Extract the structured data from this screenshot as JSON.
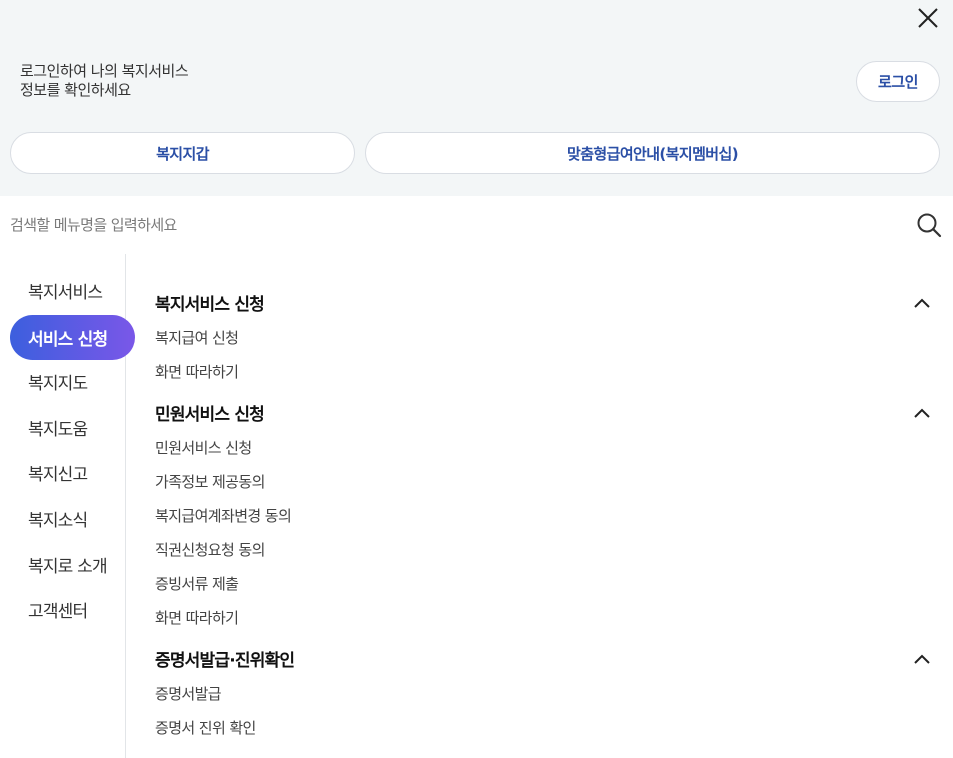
{
  "header": {
    "login_message_line1": "로그인하여 나의 복지서비스",
    "login_message_line2": "정보를 확인하세요",
    "login_label": "로그인",
    "close_icon": "close-icon"
  },
  "quick_buttons": {
    "wallet_label": "복지지갑",
    "custom_label": "맞춤형급여안내(복지멤버십)"
  },
  "search": {
    "placeholder": "검색할 메뉴명을 입력하세요",
    "icon": "search-icon"
  },
  "side_menu": {
    "items": [
      {
        "label": "복지서비스",
        "active": false
      },
      {
        "label": "서비스 신청",
        "active": true
      },
      {
        "label": "복지지도",
        "active": false
      },
      {
        "label": "복지도움",
        "active": false
      },
      {
        "label": "복지신고",
        "active": false
      },
      {
        "label": "복지소식",
        "active": false
      },
      {
        "label": "복지로 소개",
        "active": false
      },
      {
        "label": "고객센터",
        "active": false
      }
    ],
    "active_gradient": [
      "#3c5fde",
      "#7a57e8"
    ]
  },
  "sections": [
    {
      "title": "복지서비스 신청",
      "links": [
        "복지급여 신청",
        "화면 따라하기"
      ]
    },
    {
      "title": "민원서비스 신청",
      "links": [
        "민원서비스 신청",
        "가족정보 제공동의",
        "복지급여계좌변경 동의",
        "직권신청요청 동의",
        "증빙서류 제출",
        "화면 따라하기"
      ]
    },
    {
      "title": "증명서발급·진위확인",
      "links": [
        "증명서발급",
        "증명서 진위 확인"
      ]
    }
  ],
  "colors": {
    "accent_text": "#2b4fa6",
    "top_background": "#f3f6f7"
  }
}
